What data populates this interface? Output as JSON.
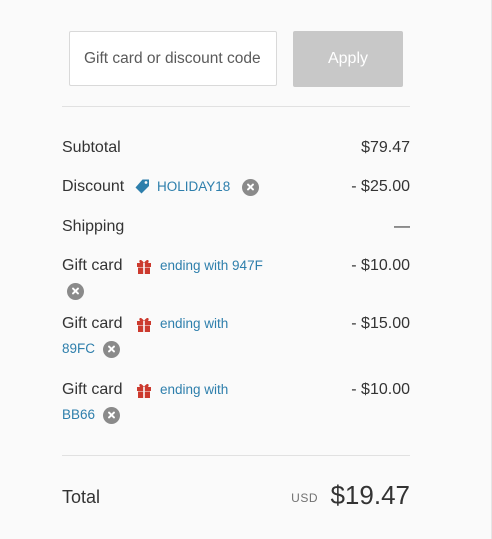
{
  "discount_form": {
    "placeholder": "Gift card or discount code",
    "apply_label": "Apply"
  },
  "subtotal": {
    "label": "Subtotal",
    "value": "$79.47"
  },
  "discount": {
    "label": "Discount",
    "code": "HOLIDAY18",
    "value": "- $25.00",
    "icon": "tag-icon"
  },
  "shipping": {
    "label": "Shipping",
    "value": "—"
  },
  "gift_cards": [
    {
      "label": "Gift card",
      "text": "ending with 947F",
      "value": "- $10.00",
      "icon": "gift-icon"
    },
    {
      "label": "Gift card",
      "text_line1": "ending with",
      "text_line2": "89FC",
      "value": "- $15.00",
      "icon": "gift-icon"
    },
    {
      "label": "Gift card",
      "text_line1": "ending with",
      "text_line2": "BB66",
      "value": "- $10.00",
      "icon": "gift-icon"
    }
  ],
  "total": {
    "label": "Total",
    "currency": "USD",
    "amount": "$19.47"
  },
  "colors": {
    "background": "#fafafa",
    "link_blue": "#2e7fac",
    "apply_button": "#c8c8c8",
    "gift_red": "#cc3a2e",
    "remove_gray": "#8a8a8a"
  }
}
